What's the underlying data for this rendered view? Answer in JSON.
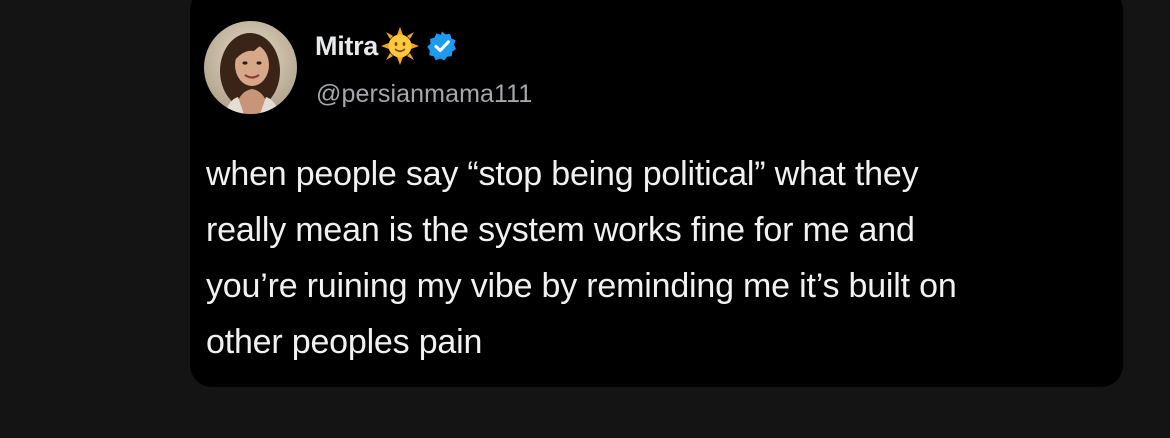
{
  "page": {
    "background_color": "#141414",
    "card_color": "#000000"
  },
  "tweet": {
    "author": {
      "display_name": "Mitra",
      "name_emoji": "sun-emoji",
      "verified": true,
      "verified_badge_color": "#1d9bf0",
      "handle": "@persianmama111"
    },
    "text_lines": [
      "when people say “stop being political” what they",
      "really mean is the system works fine for me and",
      "you’re ruining my vibe by reminding me it’s built on",
      "other peoples pain"
    ],
    "text_color": "#f1f1f1",
    "handle_color": "#a3a8ad"
  }
}
